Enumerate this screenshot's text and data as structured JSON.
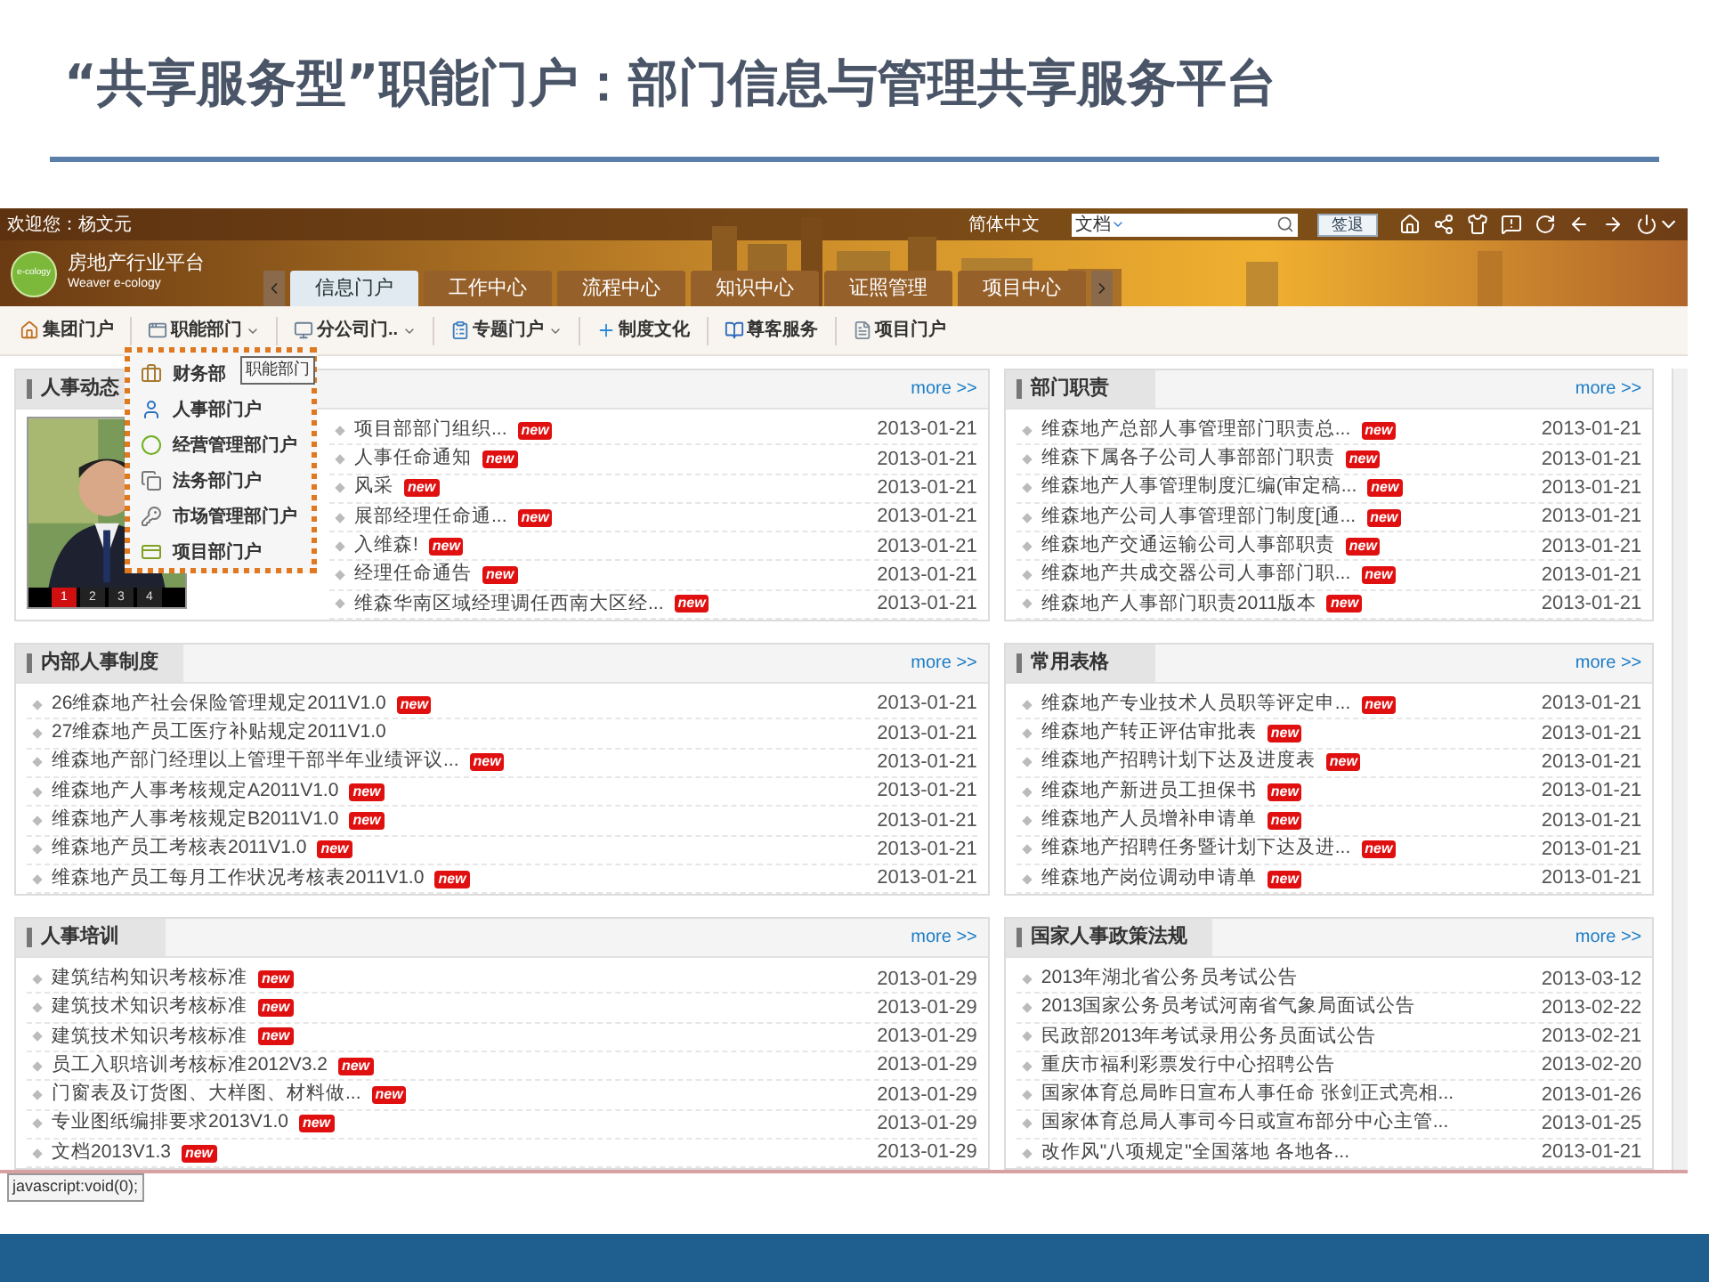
{
  "slide": {
    "title": "“共享服务型”职能门户：部门信息与管理共享服务平台"
  },
  "portal": {
    "welcome": "欢迎您：杨文元",
    "language": "简体中文",
    "search": {
      "scope": "文档"
    },
    "logout": "签退",
    "logo_text": "e-cology",
    "platform": "房地产行业平台",
    "brand": "Weaver e-cology",
    "tabs": [
      {
        "label": "信息门户",
        "selected": true
      },
      {
        "label": "工作中心",
        "selected": false
      },
      {
        "label": "流程中心",
        "selected": false
      },
      {
        "label": "知识中心",
        "selected": false
      },
      {
        "label": "证照管理",
        "selected": false
      },
      {
        "label": "项目中心",
        "selected": false
      }
    ],
    "nav": [
      {
        "label": "集团门户",
        "kind": "house",
        "dropdown": false
      },
      {
        "label": "职能部门",
        "kind": "window",
        "dropdown": true
      },
      {
        "label": "分公司门..",
        "kind": "computer",
        "dropdown": true
      },
      {
        "label": "专题门户",
        "kind": "clipboard",
        "dropdown": true
      },
      {
        "label": "制度文化",
        "kind": "plus",
        "dropdown": false
      },
      {
        "label": "尊客服务",
        "kind": "book",
        "dropdown": false
      },
      {
        "label": "项目门户",
        "kind": "doc",
        "dropdown": false
      }
    ],
    "nav_menu": {
      "tooltip": "职能部门",
      "items": [
        {
          "label": "财务部",
          "kind": "briefcase"
        },
        {
          "label": "人事部门户",
          "kind": "user"
        },
        {
          "label": "经营管理部门户",
          "kind": "ball"
        },
        {
          "label": "法务部门户",
          "kind": "copy"
        },
        {
          "label": "市场管理部门户",
          "kind": "key"
        },
        {
          "label": "项目部门户",
          "kind": "card"
        }
      ]
    },
    "panels": [
      {
        "title": "人事动态",
        "more": "more >>",
        "photo": {
          "kind": "picture",
          "pager": [
            {
              "label": "1",
              "selected": true
            },
            {
              "label": "2",
              "selected": false
            },
            {
              "label": "3",
              "selected": false
            },
            {
              "label": "4",
              "selected": false
            }
          ]
        },
        "rows": [
          {
            "text": "项目部部门组织...",
            "date": "2013-01-21",
            "badge": "new"
          },
          {
            "text": "人事任命通知",
            "date": "2013-01-21",
            "badge": "new"
          },
          {
            "text": "风采",
            "date": "2013-01-21",
            "badge": "new"
          },
          {
            "text": "展部经理任命通...",
            "date": "2013-01-21",
            "badge": "new"
          },
          {
            "text": "入维森!",
            "date": "2013-01-21",
            "badge": "new"
          },
          {
            "text": "经理任命通告",
            "date": "2013-01-21",
            "badge": "new"
          },
          {
            "text": "维森华南区域经理调任西南大区经...",
            "date": "2013-01-21",
            "badge": "new"
          }
        ]
      },
      {
        "title": "部门职责",
        "more": "more >>",
        "rows": [
          {
            "text": "维森地产总部人事管理部门职责总...",
            "date": "2013-01-21",
            "badge": "new"
          },
          {
            "text": "维森下属各子公司人事部部门职责",
            "date": "2013-01-21",
            "badge": "new"
          },
          {
            "text": "维森地产人事管理制度汇编(审定稿...",
            "date": "2013-01-21",
            "badge": "new"
          },
          {
            "text": "维森地产公司人事管理部门制度[通...",
            "date": "2013-01-21",
            "badge": "new"
          },
          {
            "text": "维森地产交通运输公司人事部职责",
            "date": "2013-01-21",
            "badge": "new"
          },
          {
            "text": "维森地产共成交器公司人事部门职...",
            "date": "2013-01-21",
            "badge": "new"
          },
          {
            "text": "维森地产人事部门职责2011版本",
            "date": "2013-01-21",
            "badge": "new"
          }
        ]
      },
      {
        "title": "内部人事制度",
        "more": "more >>",
        "rows": [
          {
            "text": "26维森地产社会保险管理规定2011V1.0",
            "date": "2013-01-21",
            "badge": "new"
          },
          {
            "text": "27维森地产员工医疗补贴规定2011V1.0",
            "date": "2013-01-21"
          },
          {
            "text": "维森地产部门经理以上管理干部半年业绩评议...",
            "date": "2013-01-21",
            "badge": "new"
          },
          {
            "text": "维森地产人事考核规定A2011V1.0",
            "date": "2013-01-21",
            "badge": "new"
          },
          {
            "text": "维森地产人事考核规定B2011V1.0",
            "date": "2013-01-21",
            "badge": "new"
          },
          {
            "text": "维森地产员工考核表2011V1.0",
            "date": "2013-01-21",
            "badge": "new"
          },
          {
            "text": "维森地产员工每月工作状况考核表2011V1.0",
            "date": "2013-01-21",
            "badge": "new"
          }
        ]
      },
      {
        "title": "常用表格",
        "more": "more >>",
        "rows": [
          {
            "text": "维森地产专业技术人员职等评定申...",
            "date": "2013-01-21",
            "badge": "new"
          },
          {
            "text": "维森地产转正评估审批表",
            "date": "2013-01-21",
            "badge": "new"
          },
          {
            "text": "维森地产招聘计划下达及进度表",
            "date": "2013-01-21",
            "badge": "new"
          },
          {
            "text": "维森地产新进员工担保书",
            "date": "2013-01-21",
            "badge": "new"
          },
          {
            "text": "维森地产人员增补申请单",
            "date": "2013-01-21",
            "badge": "new"
          },
          {
            "text": "维森地产招聘任务暨计划下达及进...",
            "date": "2013-01-21",
            "badge": "new"
          },
          {
            "text": "维森地产岗位调动申请单",
            "date": "2013-01-21",
            "badge": "new"
          }
        ]
      },
      {
        "title": "人事培训",
        "more": "more >>",
        "rows": [
          {
            "text": "建筑结构知识考核标准",
            "date": "2013-01-29",
            "badge": "new"
          },
          {
            "text": "建筑技术知识考核标准",
            "date": "2013-01-29",
            "badge": "new"
          },
          {
            "text": "建筑技术知识考核标准",
            "date": "2013-01-29",
            "badge": "new"
          },
          {
            "text": "员工入职培训考核标准2012V3.2",
            "date": "2013-01-29",
            "badge": "new"
          },
          {
            "text": "门窗表及订货图、大样图、材料做...",
            "date": "2013-01-29",
            "badge": "new"
          },
          {
            "text": "专业图纸编排要求2013V1.0",
            "date": "2013-01-29",
            "badge": "new"
          },
          {
            "text": "文档2013V1.3",
            "date": "2013-01-29",
            "badge": "new"
          }
        ]
      },
      {
        "title": "国家人事政策法规",
        "more": "more >>",
        "rows": [
          {
            "text": "2013年湖北省公务员考试公告",
            "date": "2013-03-12"
          },
          {
            "text": "2013国家公务员考试河南省气象局面试公告",
            "date": "2013-02-22"
          },
          {
            "text": "民政部2013年考试录用公务员面试公告",
            "date": "2013-02-21"
          },
          {
            "text": "重庆市福利彩票发行中心招聘公告",
            "date": "2013-02-20"
          },
          {
            "text": "国家体育总局昨日宣布人事任命 张剑正式亮相...",
            "date": "2013-01-26"
          },
          {
            "text": "国家体育总局人事司今日或宣布部分中心主管...",
            "date": "2013-01-25"
          },
          {
            "text": "改作风\"八项规定\"全国落地 各地各...",
            "date": "2013-01-21"
          }
        ]
      }
    ],
    "status_tooltip": "javascript:void(0);"
  }
}
